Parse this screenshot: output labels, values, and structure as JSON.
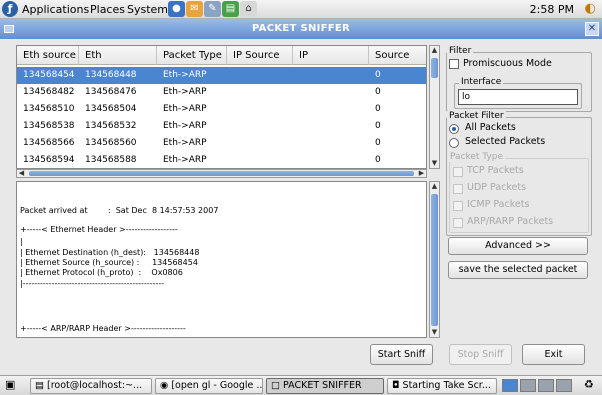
{
  "top_panel": {
    "menus": [
      "Applications",
      "Places",
      "System"
    ],
    "clock": "2:58 PM"
  },
  "window": {
    "title": "PACKET SNIFFER"
  },
  "packet_table": {
    "columns": [
      "Eth source",
      "Eth Destination",
      "Packet Type",
      "IP Source",
      "IP Destination",
      "Source Port"
    ],
    "rows": [
      [
        "134568454",
        "134568448",
        "Eth->ARP",
        "",
        "",
        "0"
      ],
      [
        "134568482",
        "134568476",
        "Eth->ARP",
        "",
        "",
        "0"
      ],
      [
        "134568510",
        "134568504",
        "Eth->ARP",
        "",
        "",
        "0"
      ],
      [
        "134568538",
        "134568532",
        "Eth->ARP",
        "",
        "",
        "0"
      ],
      [
        "134568566",
        "134568560",
        "Eth->ARP",
        "",
        "",
        "0"
      ],
      [
        "134568594",
        "134568588",
        "Eth->ARP",
        "",
        "",
        "0"
      ]
    ],
    "selected_row": 0
  },
  "details": {
    "lines": [
      "Packet arrived at        :  Sat Dec  8 14:57:53 2007",
      "+-----< Ethernet Header >------------------",
      "|",
      "| Ethernet Destination (h_dest):   134568448",
      "| Ethernet Source (h_source) :     134568454",
      "| Ethernet Protocol (h_proto)  :    Ox0806",
      "|-------------------------------------------------",
      "+-----< ARP/RARP Header >-------------------"
    ]
  },
  "filter": {
    "legend": "Filter",
    "promiscuous_label": "Promiscuous Mode",
    "promiscuous_checked": false,
    "interface_legend": "Interface",
    "interface_value": "lo"
  },
  "packet_filter": {
    "legend": "Packet Filter",
    "options": [
      "All Packets",
      "Selected Packets"
    ],
    "selected": "All Packets",
    "packet_type_legend": "Packet Type",
    "packet_types": [
      "TCP Packets",
      "UDP Packets",
      "ICMP Packets",
      "ARP/RARP Packets"
    ]
  },
  "buttons": {
    "advanced": "Advanced >>",
    "save_selected": "save the selected packet",
    "start_sniff": "Start Sniff",
    "stop_sniff": "Stop Sniff",
    "exit": "Exit"
  },
  "taskbar": {
    "tasks": [
      "[root@localhost:~...",
      "[open gl - Google ...",
      "PACKET SNIFFER",
      "Starting Take Scr..."
    ],
    "active_task": "PACKET SNIFFER"
  }
}
